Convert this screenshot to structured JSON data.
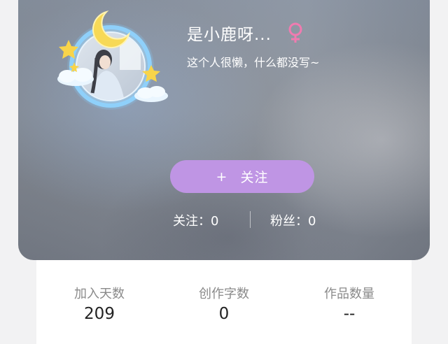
{
  "profile": {
    "username": "是小鹿呀...",
    "bio": "这个人很懒，什么都没写~",
    "gender_icon": "female-icon",
    "gender_color": "#f07bb0"
  },
  "follow_button": {
    "icon": "+",
    "label": "关注",
    "color": "#bf95e4"
  },
  "social": {
    "following_label": "关注：",
    "following_count": "0",
    "fans_label": "粉丝：",
    "fans_count": "0"
  },
  "stats": [
    {
      "label": "加入天数",
      "value": "209"
    },
    {
      "label": "创作字数",
      "value": "0"
    },
    {
      "label": "作品数量",
      "value": "--"
    }
  ]
}
